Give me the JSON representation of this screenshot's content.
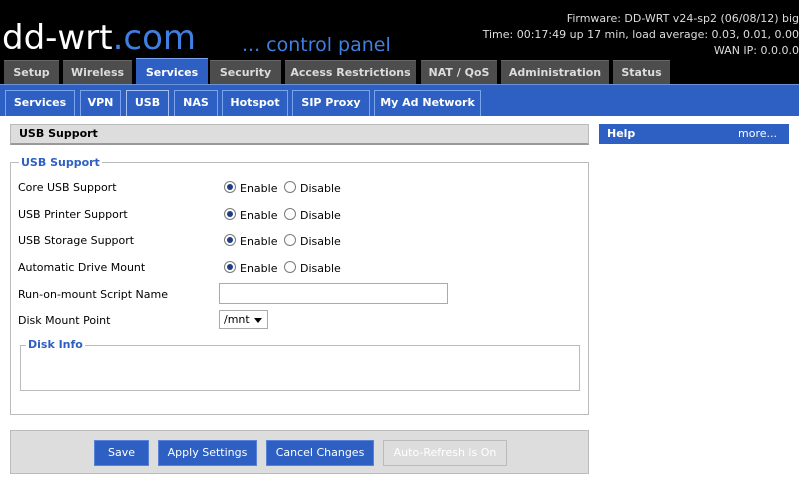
{
  "header": {
    "logo_main": "dd-wrt",
    "logo_suffix": ".com",
    "subtitle": "... control panel",
    "firmware": "Firmware: DD-WRT v24-sp2 (06/08/12) big",
    "time": "Time: 00:17:49 up 17 min, load average: 0.03, 0.01, 0.00",
    "wan_ip": "WAN IP: 0.0.0.0"
  },
  "tabs": [
    "Setup",
    "Wireless",
    "Services",
    "Security",
    "Access Restrictions",
    "NAT / QoS",
    "Administration",
    "Status"
  ],
  "subtabs": [
    "Services",
    "VPN",
    "USB",
    "NAS",
    "Hotspot",
    "SIP Proxy",
    "My Ad Network"
  ],
  "section_title": "USB Support",
  "help": {
    "title": "Help",
    "more": "more..."
  },
  "form": {
    "legend": "USB Support",
    "rows": [
      {
        "label": "Core USB Support",
        "enable": "Enable",
        "disable": "Disable",
        "value": "Enable"
      },
      {
        "label": "USB Printer Support",
        "enable": "Enable",
        "disable": "Disable",
        "value": "Enable"
      },
      {
        "label": "USB Storage Support",
        "enable": "Enable",
        "disable": "Disable",
        "value": "Enable"
      },
      {
        "label": "Automatic Drive Mount",
        "enable": "Enable",
        "disable": "Disable",
        "value": "Enable"
      }
    ],
    "script_label": "Run-on-mount Script Name",
    "script_value": "",
    "mount_label": "Disk Mount Point",
    "mount_value": "/mnt",
    "disk_info_legend": "Disk Info"
  },
  "buttons": {
    "save": "Save",
    "apply": "Apply Settings",
    "cancel": "Cancel Changes",
    "autorefresh": "Auto-Refresh is On"
  },
  "colors": {
    "accent": "#2d60c2",
    "header_bg": "#000000",
    "tab_bg": "#4d4d4d",
    "panel_bg": "#dddddd"
  }
}
